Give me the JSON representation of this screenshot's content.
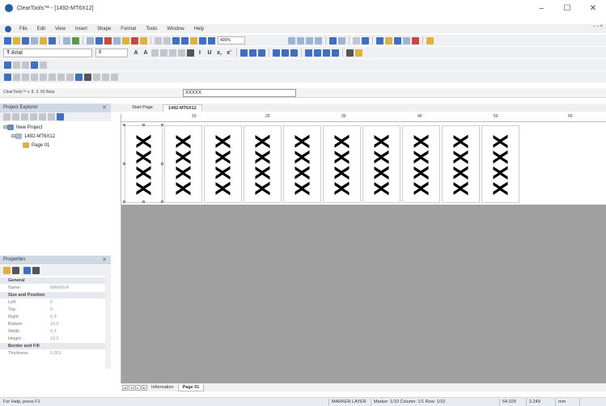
{
  "window": {
    "title": "ClearTools™ - [1492-MT6X12]",
    "minimize_glyph": "–",
    "maximize_glyph": "☐",
    "close_glyph": "✕"
  },
  "menubar": {
    "items": [
      "File",
      "Edit",
      "View",
      "Insert",
      "Shape",
      "Format",
      "Tools",
      "Window",
      "Help"
    ],
    "right_glyphs": "– ▫ ×"
  },
  "toolbar": {
    "zoom": "400%",
    "font": "Arial",
    "size": "8",
    "font_size_labels": [
      "A",
      "A"
    ],
    "format_labels": [
      "B",
      "I",
      "U",
      "x,",
      "x'"
    ]
  },
  "address": {
    "version": "ClearTools™ v. 8. 3. 65 Beta",
    "marker_field": "XXXXX"
  },
  "project_explorer": {
    "title": "Project Explorer",
    "close_glyph": "✕",
    "tree": [
      "New Project",
      "1492-MT6X12",
      "Page 01"
    ]
  },
  "properties": {
    "title": "Properties",
    "close_glyph": "✕",
    "rows": [
      {
        "type": "category",
        "label": "General"
      },
      {
        "type": "prop",
        "label": "Name",
        "value": "MARKER"
      },
      {
        "type": "category",
        "label": "Size and Position"
      },
      {
        "type": "prop",
        "label": "Left",
        "value": "0"
      },
      {
        "type": "prop",
        "label": "Top",
        "value": "0"
      },
      {
        "type": "prop",
        "label": "Right",
        "value": "5.3"
      },
      {
        "type": "prop",
        "label": "Bottom",
        "value": "10.5"
      },
      {
        "type": "prop",
        "label": "Width",
        "value": "5.3"
      },
      {
        "type": "prop",
        "label": "Height",
        "value": "10.5"
      },
      {
        "type": "category",
        "label": "Border and Fill"
      },
      {
        "type": "prop",
        "label": "Thickness",
        "value": "0.001"
      }
    ]
  },
  "doc_tabs": [
    "Start Page",
    "1492-MT6X12"
  ],
  "ruler_labels": [
    "10",
    "20",
    "30",
    "40",
    "50",
    "60"
  ],
  "markers": [
    "XXXX",
    "XXXX",
    "XXXX",
    "XXXX",
    "XXXX",
    "XXXX",
    "XXXX",
    "XXXX",
    "XXXX",
    "XXXX"
  ],
  "sheet_tabs": [
    "Information",
    "Page 01"
  ],
  "status": {
    "help": "For Help, press F1",
    "layer": "MARKER LAYER",
    "position": "Marker: 1/10 Column: 1/1 Row: 1/10",
    "x": "64.029",
    "y": "2.249",
    "unit": "mm"
  }
}
